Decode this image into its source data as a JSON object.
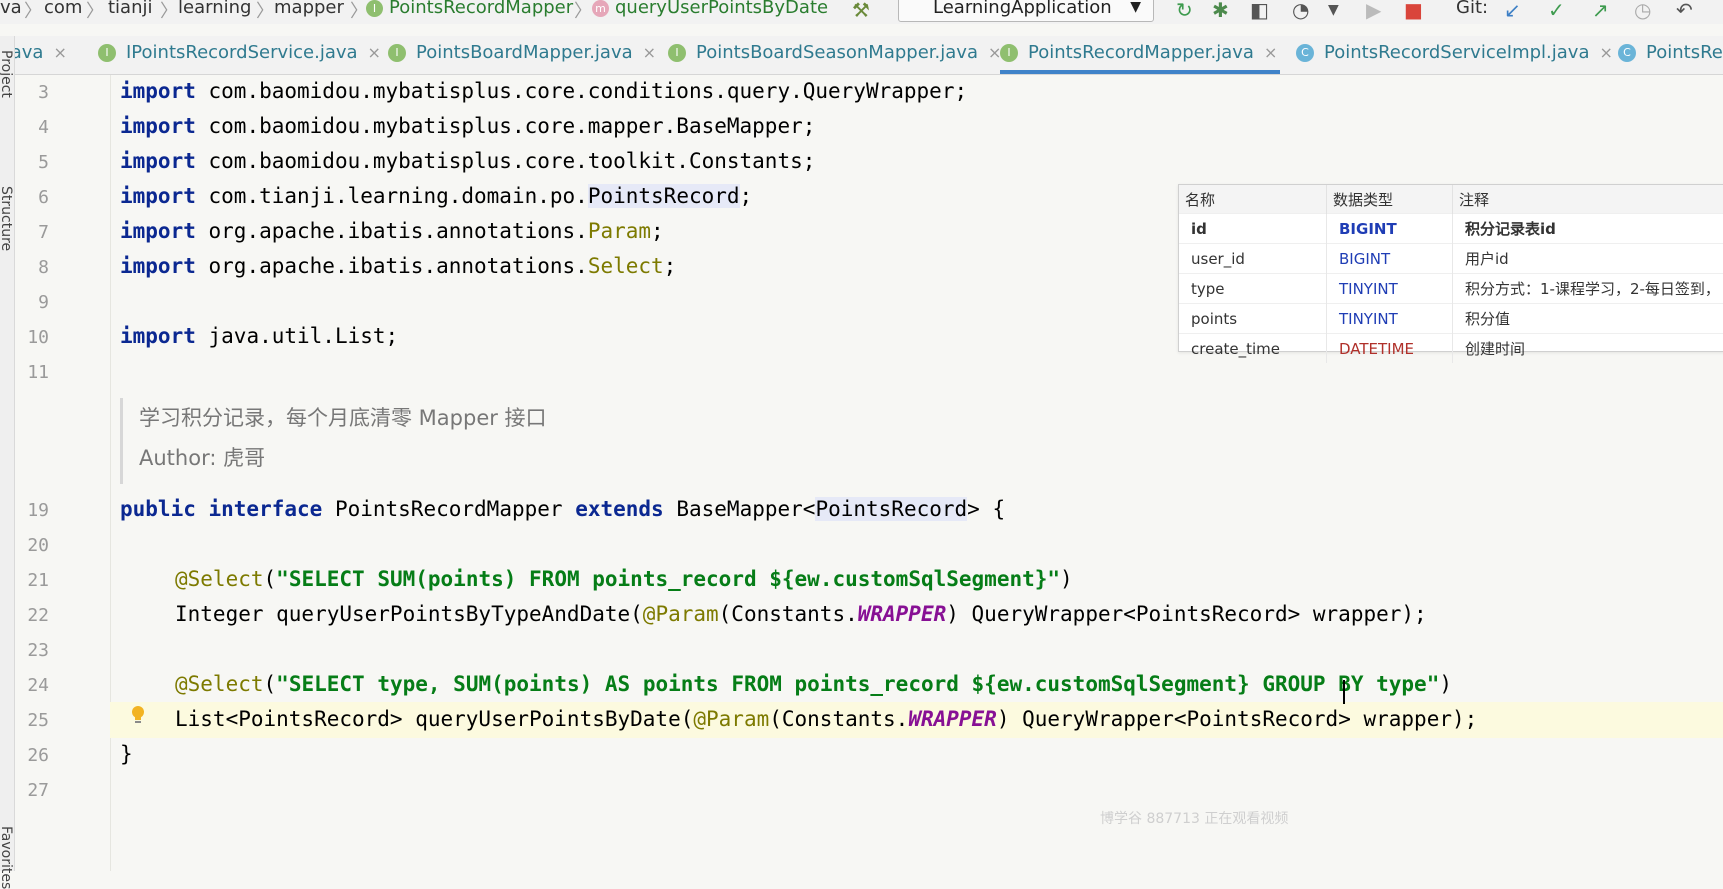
{
  "breadcrumb": [
    "va",
    "com",
    "tianji",
    "learning",
    "mapper",
    "PointsRecordMapper",
    "queryUserPointsByDate"
  ],
  "run_config": "LearningApplication",
  "git_label": "Git:",
  "icons": {
    "interface": "I",
    "method": "m",
    "class": "C",
    "close": "×",
    "dropdown": "▼"
  },
  "tabs": [
    {
      "label": ".java",
      "icon": "none"
    },
    {
      "label": "IPointsRecordService.java",
      "icon": "interface"
    },
    {
      "label": "PointsBoardMapper.java",
      "icon": "interface"
    },
    {
      "label": "PointsBoardSeasonMapper.java",
      "icon": "interface"
    },
    {
      "label": "PointsRecordMapper.java",
      "icon": "interface",
      "active": true
    },
    {
      "label": "PointsRecordServiceImpl.java",
      "icon": "class"
    },
    {
      "label": "PointsRec",
      "icon": "class"
    }
  ],
  "tool_windows": [
    "Project",
    "Structure",
    "Favorites"
  ],
  "line_numbers": [
    "3",
    "4",
    "5",
    "6",
    "7",
    "8",
    "9",
    "10",
    "11",
    "19",
    "20",
    "21",
    "22",
    "23",
    "24",
    "25",
    "26",
    "27"
  ],
  "code": {
    "l3": "com.baomidou.mybatisplus.core.conditions.query.QueryWrapper;",
    "l4": "com.baomidou.mybatisplus.core.mapper.BaseMapper;",
    "l5": "com.baomidou.mybatisplus.core.toolkit.Constants;",
    "l6a": "com.tianji.learning.domain.po.",
    "l6b": "PointsRecord",
    "l6c": ";",
    "l7a": "org.apache.ibatis.annotations.",
    "l7b": "Param",
    "l7c": ";",
    "l8a": "org.apache.ibatis.annotations.",
    "l8b": "Select",
    "l8c": ";",
    "l10": "java.util.List;",
    "kw_import": "import",
    "doc1": "学习积分记录，每个月底清零 Mapper 接口",
    "doc2": "Author: 虎哥",
    "l19_kw1": "public interface",
    "l19_name": "PointsRecordMapper",
    "l19_kw2": "extends",
    "l19_base": "BaseMapper<",
    "l19_type": "PointsRecord",
    "l19_end": "> {",
    "ann_select": "@Select",
    "ann_param": "@Param",
    "l21_str": "\"SELECT SUM(points) FROM points_record ${ew.customSqlSegment}\"",
    "l22a": "Integer queryUserPointsByTypeAndDate(",
    "l22b": "(Constants.",
    "const_wrapper": "WRAPPER",
    "l22c": ") QueryWrapper<PointsRecord> wrapper);",
    "l24_str": "\"SELECT type, SUM(points) AS points FROM points_record ${ew.customSqlSegment} GROUP BY type\"",
    "l25a": "List<PointsRecord> queryUserPointsByDate(",
    "l25c": ") QueryWrapper<PointsRecord> wrapper);",
    "l26": "}",
    "paren_open": "(",
    "paren_close": ")"
  },
  "column_table": {
    "headers": [
      "名称",
      "数据类型",
      "注释"
    ],
    "rows": [
      {
        "name": "id",
        "type": "BIGINT",
        "comment": "积分记录表id"
      },
      {
        "name": "user_id",
        "type": "BIGINT",
        "comment": "用户id"
      },
      {
        "name": "type",
        "type": "TINYINT",
        "comment": "积分方式：1-课程学习，2-每日签到，"
      },
      {
        "name": "points",
        "type": "TINYINT",
        "comment": "积分值"
      },
      {
        "name": "create_time",
        "type": "DATETIME",
        "comment": "创建时间"
      }
    ]
  },
  "watermark": "博学谷 887713 正在观看视频"
}
